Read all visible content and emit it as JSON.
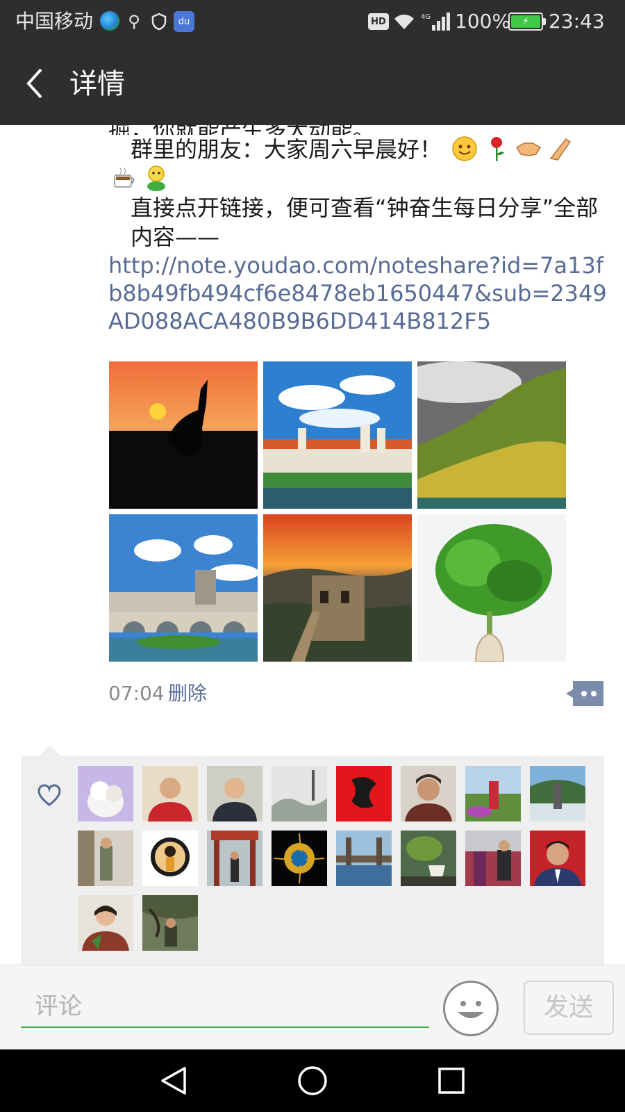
{
  "status_bar": {
    "carrier": "中国移动",
    "battery": "100%",
    "time": "23:43",
    "network": "4G",
    "hd_label": "HD",
    "baidu_label": "du"
  },
  "header": {
    "back_icon": "chevron-left-icon",
    "title": "详情"
  },
  "post": {
    "partial_line": "掘，你就能产生多大动能。",
    "greeting": "群里的朋友：大家周六早晨好！",
    "instruction": "直接点开链接，便可查看“钟奋生每日分享”全部内容——",
    "link": "http://note.youdao.com/noteshare?id=7a13fb8b49fb494cf6e8478eb1650447&sub=2349AD088ACA480B9B6DD414B812F5",
    "emojis": [
      "smile-emoji",
      "rose-emoji",
      "handshake-emoji",
      "clap-emoji",
      "coffee-emoji",
      "cute-emoji"
    ],
    "photos": [
      {
        "subject": "crane at sunset"
      },
      {
        "subject": "town with castle"
      },
      {
        "subject": "green mountain valley"
      },
      {
        "subject": "cathedral and bridge"
      },
      {
        "subject": "great wall at sunset"
      },
      {
        "subject": "green plant in vase"
      }
    ],
    "time": "07:04",
    "delete_label": "删除",
    "comment_icon": "comment-dots-icon"
  },
  "likes": {
    "icon": "heart-icon",
    "count_avatars": 18
  },
  "comment_bar": {
    "placeholder": "评论",
    "emoji_icon": "smiley-icon",
    "send_label": "发送"
  },
  "nav": {
    "back_icon": "triangle-back-icon",
    "home_icon": "circle-home-icon",
    "recent_icon": "square-recent-icon"
  },
  "colors": {
    "bar_bg": "#2e2e2e",
    "link": "#576b95",
    "input_accent": "#3cb043",
    "panel_bg": "#efefef"
  }
}
